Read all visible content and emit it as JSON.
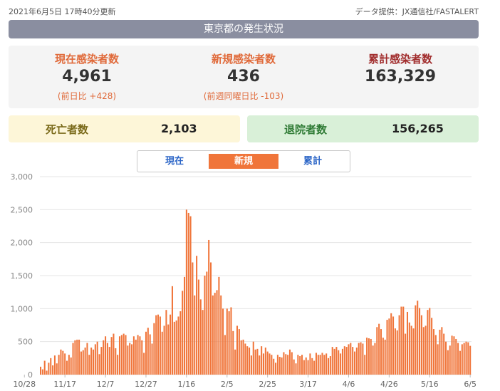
{
  "header": {
    "timestamp": "2021年6月5日 17時40分更新",
    "source": "データ提供：JX通信社/FASTALERT",
    "title": "東京都の発生状況"
  },
  "stats": {
    "current": {
      "label": "現在感染者数",
      "value": "4,961",
      "sub": "(前日比 +428)"
    },
    "new": {
      "label": "新規感染者数",
      "value": "436",
      "sub": "(前週同曜日比 -103)"
    },
    "total": {
      "label": "累計感染者数",
      "value": "163,329"
    }
  },
  "deaths": {
    "label": "死亡者数",
    "value": "2,103"
  },
  "discharged": {
    "label": "退院者数",
    "value": "156,265"
  },
  "tabs": [
    {
      "label": "現在",
      "active": false
    },
    {
      "label": "新規",
      "active": true
    },
    {
      "label": "累計",
      "active": false
    }
  ],
  "colors": {
    "bar": "#f0753a",
    "accent": "#e06a3a",
    "total_label": "#a12d2d",
    "title_bg": "#8a8ea0"
  },
  "chart_data": {
    "type": "bar",
    "title": "",
    "xlabel": "",
    "ylabel": "",
    "ylim": [
      0,
      3000
    ],
    "yticks": [
      "0",
      "500",
      "1,000",
      "1,500",
      "2,000",
      "2,500",
      "3,000"
    ],
    "x_tick_labels": [
      "10/28",
      "11/17",
      "12/7",
      "12/27",
      "1/16",
      "2/5",
      "2/25",
      "3/17",
      "4/6",
      "4/26",
      "5/16",
      "6/5"
    ],
    "grid": true,
    "series": [
      {
        "values": [
          120,
          80,
          210,
          60,
          180,
          250,
          140,
          290,
          170,
          300,
          380,
          360,
          320,
          210,
          300,
          260,
          480,
          520,
          530,
          530,
          350,
          370,
          410,
          480,
          300,
          410,
          380,
          460,
          500,
          310,
          420,
          520,
          580,
          480,
          420,
          570,
          620,
          400,
          300,
          580,
          600,
          620,
          600,
          440,
          480,
          460,
          580,
          530,
          600,
          580,
          520,
          330,
          650,
          710,
          610,
          470,
          780,
          900,
          910,
          880,
          650,
          740,
          980,
          760,
          910,
          1340,
          800,
          820,
          880,
          960,
          1270,
          1480,
          2500,
          2450,
          2400,
          1700,
          1200,
          1800,
          1440,
          1140,
          980,
          1500,
          1560,
          2040,
          1700,
          1200,
          1240,
          1280,
          1480,
          1200,
          1000,
          600,
          1000,
          960,
          1020,
          660,
          380,
          740,
          690,
          520,
          530,
          470,
          430,
          410,
          290,
          500,
          380,
          390,
          290,
          430,
          320,
          410,
          350,
          320,
          300,
          240,
          180,
          300,
          270,
          260,
          340,
          310,
          300,
          380,
          340,
          230,
          170,
          300,
          280,
          300,
          220,
          260,
          220,
          320,
          250,
          210,
          330,
          300,
          300,
          330,
          300,
          320,
          250,
          280,
          420,
          390,
          420,
          370,
          320,
          390,
          430,
          420,
          460,
          480,
          420,
          350,
          410,
          480,
          490,
          470,
          300,
          560,
          550,
          540,
          440,
          480,
          720,
          770,
          690,
          560,
          530,
          830,
          850,
          930,
          880,
          700,
          670,
          900,
          1030,
          1030,
          620,
          950,
          790,
          740,
          700,
          1050,
          1120,
          1010,
          900,
          720,
          740,
          980,
          1010,
          860,
          690,
          600,
          460,
          680,
          720,
          620,
          500,
          370,
          440,
          590,
          580,
          540,
          480,
          360,
          460,
          480,
          500,
          490,
          436
        ]
      }
    ]
  }
}
